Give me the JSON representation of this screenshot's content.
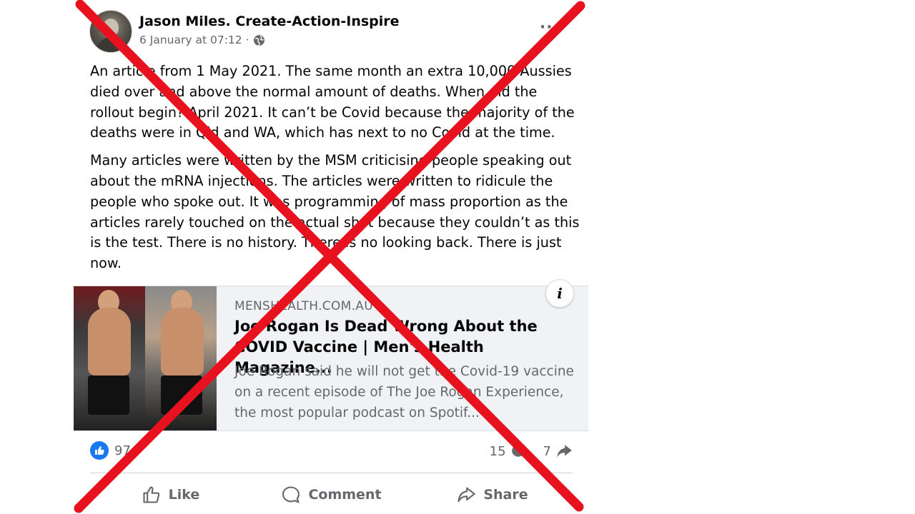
{
  "post": {
    "author": "Jason Miles. Create-Action-Inspire",
    "timestamp": "6 January at 07:12",
    "separator": "·",
    "privacy_icon": "globe-icon",
    "more_label": "···",
    "paragraphs": [
      "An article from 1 May 2021. The same month an extra 10,000 Aussies died over and above the normal amount of deaths. When did the rollout begin? April 2021. It can’t be Covid because the majority of the deaths were in Qld and WA, which has next to no Covid at the time.",
      "Many articles were written by the MSM criticising people speaking out about the mRNA injections. The articles were written to ridicule the people who spoke out. It was programming of mass proportion as the articles rarely touched on the actual shot because they couldn’t as this is the test. There is no history. There is no looking back. There is just now."
    ]
  },
  "link_card": {
    "domain": "MENSHEALTH.COM.AU",
    "title": "Joe Rogan Is Dead Wrong About the COVID Vaccine | Men's Health Magazine...",
    "description": "Joe Rogan said he will not get the Covid-19 vaccine on a recent episode of The Joe Rogan Experience, the most popular podcast on Spotif...",
    "info_label": "i"
  },
  "stats": {
    "likes": "97",
    "comments": "15",
    "shares": "7"
  },
  "actions": {
    "like": "Like",
    "comment": "Comment",
    "share": "Share"
  },
  "overlay": {
    "cross_color": "#e8121f"
  },
  "colors": {
    "facebook_blue": "#1877f2",
    "secondary_text": "#65676b"
  }
}
